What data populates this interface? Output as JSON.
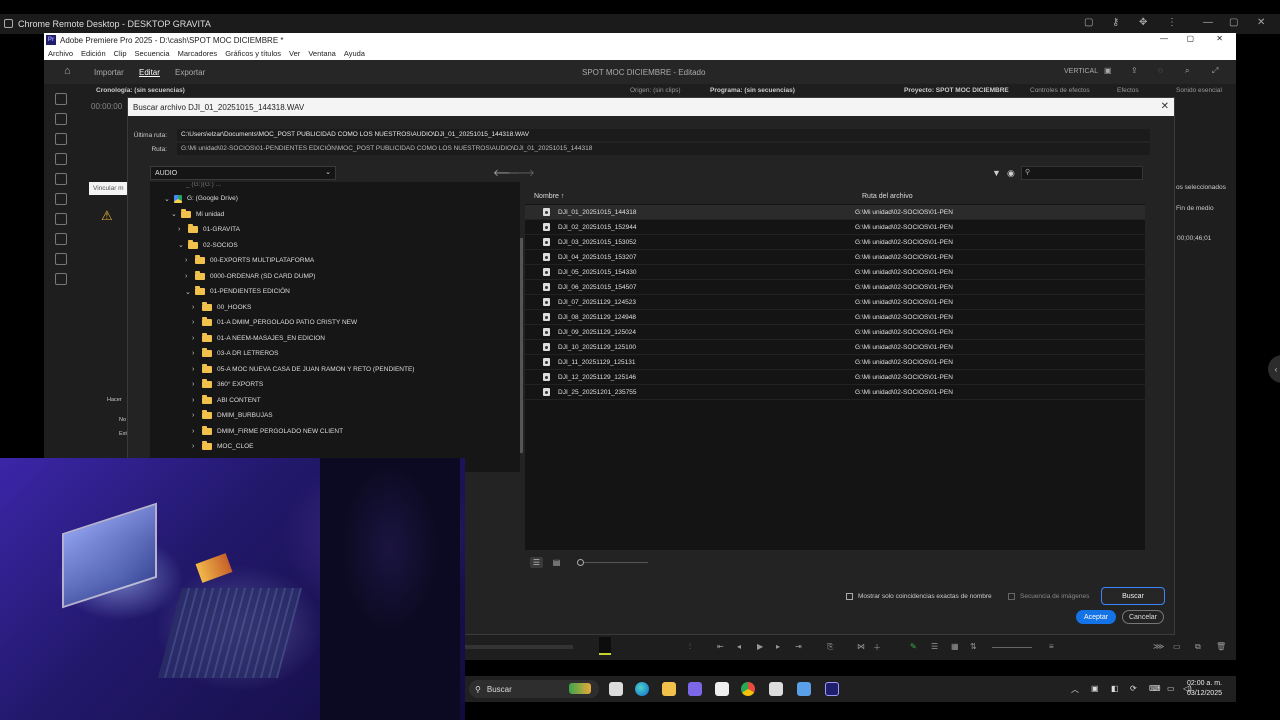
{
  "remote": {
    "title": "Chrome Remote Desktop - DESKTOP GRAVITA"
  },
  "premiere": {
    "title": "Adobe Premiere Pro 2025 - D:\\cash\\SPOT MOC DICIEMBRE *",
    "logo": "Pr",
    "menu": [
      "Archivo",
      "Edición",
      "Clip",
      "Secuencia",
      "Marcadores",
      "Gráficos y títulos",
      "Ver",
      "Ventana",
      "Ayuda"
    ],
    "workspace_tabs": {
      "importar": "Importar",
      "editar": "Editar",
      "exportar": "Exportar"
    },
    "project_title": "SPOT MOC DICIEMBRE - Editado",
    "workspace": "VERTICAL",
    "panels": {
      "timeline": "Cronología: (sin secuencias)",
      "timecode": "00:00:00",
      "source": "Origen: (sin clips)",
      "program": "Programa: (sin secuencias)",
      "project": "Proyecto: SPOT MOC DICIEMBRE",
      "effect_controls": "Controles de efectos",
      "effects": "Efectos",
      "essential_sound": "Sonido esencial",
      "selected": "os seleccionados",
      "end_media": "Fin de medio",
      "end_value": "00;00;46;01",
      "link_media": "Vincular m",
      "hacer": "Hacer",
      "no": "No",
      "ext": "Ext"
    }
  },
  "dialog": {
    "title": "Buscar archivo DJI_01_20251015_144318.WAV",
    "last_path_label": "Última ruta:",
    "last_path": "C:\\Users\\elzar\\Documents\\MOC_POST PUBLICIDAD COMO LOS NUESTROS\\AUDIO\\DJI_01_20251015_144318.WAV",
    "path_label": "Ruta:",
    "path": "G:\\Mi unidad\\02-SOCIOS\\01-PENDIENTES EDICIÓN\\MOC_POST PUBLICIDAD COMO LOS NUESTROS\\AUDIO\\DJI_01_20251015_144318",
    "location": "AUDIO",
    "tree_partial": "_ (G:)(G:) ...",
    "tree": [
      {
        "label": "G: (Google Drive)",
        "indent": 0,
        "arrow": "open",
        "icon": "gdrive"
      },
      {
        "label": "Mi unidad",
        "indent": 1,
        "arrow": "open",
        "icon": "folder"
      },
      {
        "label": "01-GRAVITA",
        "indent": 2,
        "arrow": "closed",
        "icon": "folder"
      },
      {
        "label": "02-SOCIOS",
        "indent": 2,
        "arrow": "open",
        "icon": "folder"
      },
      {
        "label": "00-EXPORTS MULTIPLATAFORMA",
        "indent": 3,
        "arrow": "closed",
        "icon": "folder"
      },
      {
        "label": "0000-ORDENAR (SD CARD DUMP)",
        "indent": 3,
        "arrow": "closed",
        "icon": "folder"
      },
      {
        "label": "01-PENDIENTES EDICIÓN",
        "indent": 3,
        "arrow": "open",
        "icon": "folder"
      },
      {
        "label": "00_HOOKS",
        "indent": 4,
        "arrow": "closed",
        "icon": "folder"
      },
      {
        "label": "01-A DMIM_PERGOLADO PATIO CRISTY NEW",
        "indent": 4,
        "arrow": "closed",
        "icon": "folder"
      },
      {
        "label": "01-A NEEM-MASAJES_EN EDICION",
        "indent": 4,
        "arrow": "closed",
        "icon": "folder"
      },
      {
        "label": "03-A DR LETREROS",
        "indent": 4,
        "arrow": "closed",
        "icon": "folder"
      },
      {
        "label": "05-A MOC NUEVA CASA DE JUAN RAMON Y RETO (PENDIENTE)",
        "indent": 4,
        "arrow": "closed",
        "icon": "folder"
      },
      {
        "label": "360° EXPORTS",
        "indent": 4,
        "arrow": "closed",
        "icon": "folder"
      },
      {
        "label": "ABI CONTENT",
        "indent": 4,
        "arrow": "closed",
        "icon": "folder"
      },
      {
        "label": "DMIM_BURBUJAS",
        "indent": 4,
        "arrow": "closed",
        "icon": "folder"
      },
      {
        "label": "DMIM_FIRME PERGOLADO NEW CLIENT",
        "indent": 4,
        "arrow": "closed",
        "icon": "folder"
      },
      {
        "label": "MOC_CLOE",
        "indent": 4,
        "arrow": "closed",
        "icon": "folder"
      }
    ],
    "columns": {
      "name": "Nombre",
      "sort": "↑",
      "path": "Ruta del archivo"
    },
    "files": [
      {
        "name": "DJI_01_20251015_144318",
        "path": "G:\\Mi unidad\\02-SOCIOS\\01-PEN"
      },
      {
        "name": "DJI_02_20251015_152944",
        "path": "G:\\Mi unidad\\02-SOCIOS\\01-PEN"
      },
      {
        "name": "DJI_03_20251015_153052",
        "path": "G:\\Mi unidad\\02-SOCIOS\\01-PEN"
      },
      {
        "name": "DJI_04_20251015_153207",
        "path": "G:\\Mi unidad\\02-SOCIOS\\01-PEN"
      },
      {
        "name": "DJI_05_20251015_154330",
        "path": "G:\\Mi unidad\\02-SOCIOS\\01-PEN"
      },
      {
        "name": "DJI_06_20251015_154507",
        "path": "G:\\Mi unidad\\02-SOCIOS\\01-PEN"
      },
      {
        "name": "DJI_07_20251129_124523",
        "path": "G:\\Mi unidad\\02-SOCIOS\\01-PEN"
      },
      {
        "name": "DJI_08_20251129_124948",
        "path": "G:\\Mi unidad\\02-SOCIOS\\01-PEN"
      },
      {
        "name": "DJI_09_20251129_125024",
        "path": "G:\\Mi unidad\\02-SOCIOS\\01-PEN"
      },
      {
        "name": "DJI_10_20251129_125100",
        "path": "G:\\Mi unidad\\02-SOCIOS\\01-PEN"
      },
      {
        "name": "DJI_11_20251129_125131",
        "path": "G:\\Mi unidad\\02-SOCIOS\\01-PEN"
      },
      {
        "name": "DJI_12_20251129_125146",
        "path": "G:\\Mi unidad\\02-SOCIOS\\01-PEN"
      },
      {
        "name": "DJI_25_20251201_235755",
        "path": "G:\\Mi unidad\\02-SOCIOS\\01-PEN"
      }
    ],
    "exact_match_label": "Mostrar solo coincidencias exactas de nombre",
    "image_sequence_label": "Secuencia de imágenes",
    "buscar": "Buscar",
    "aceptar": "Aceptar",
    "cancelar": "Cancelar"
  },
  "taskbar": {
    "search": "Buscar",
    "time": "02:00 a. m.",
    "date": "03/12/2025"
  },
  "colors": {
    "accent": "#1473e6",
    "folder": "#f2c14c"
  }
}
